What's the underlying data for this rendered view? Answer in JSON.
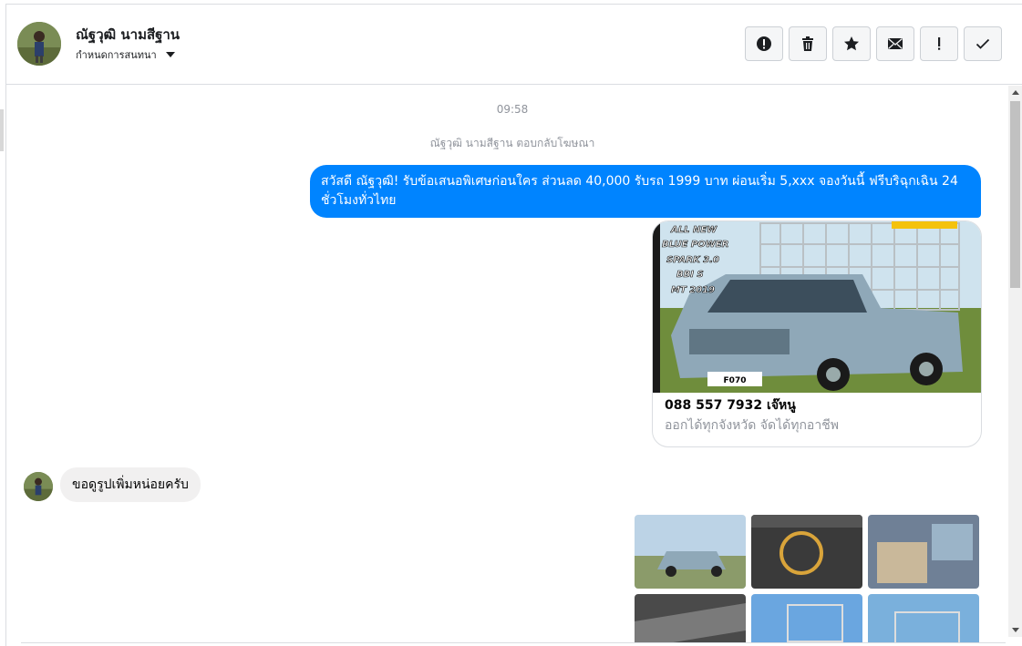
{
  "header": {
    "contact_name": "ณัฐวุฒิ นามสีฐาน",
    "conversation_settings": "กำหนดการสนทนา"
  },
  "toolbar": {
    "buttons": [
      "alert-icon",
      "trash-icon",
      "star-icon",
      "envelope-icon",
      "exclamation-icon",
      "check-icon"
    ]
  },
  "chat": {
    "timestamp": "09:58",
    "reply_note": "ณัฐวุฒิ นามสีฐาน ตอบกลับโฆษณา",
    "outgoing_message": "สวัสดี ณัฐวุฒิ! รับข้อเสนอพิเศษก่อนใคร ส่วนลด 40,000 รับรถ 1999 บาท ผ่อนเริ่ม 5,xxx จองวันนี้ ฟรีบริฉุกเฉิน 24 ชั่วโมงทั่วไทย",
    "ad_card": {
      "image_text": [
        "ALL NEW",
        "BLUE POWER",
        "SPARK 3.0",
        "BBI S",
        "MT 2019"
      ],
      "plate": "F070",
      "title": "088 557 7932 เจ๊หนู",
      "subtitle": "ออกได้ทุกจังหวัด จัดได้ทุกอาชีพ"
    },
    "incoming_message": "ขอดูรูปเพิ่มหน่อยครับ"
  },
  "colors": {
    "messenger_blue": "#0084ff",
    "incoming_bubble": "#f1f0f0",
    "meta_text": "#90949c"
  }
}
